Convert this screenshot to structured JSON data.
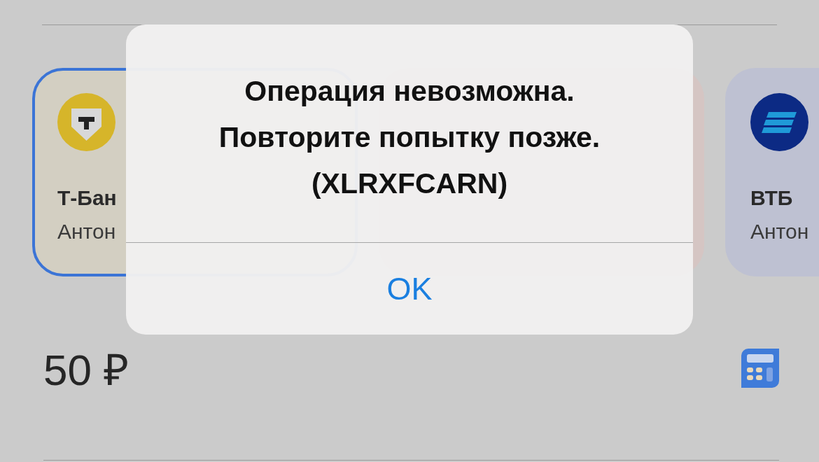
{
  "cards": [
    {
      "kind": "t",
      "name": "Т-Бан",
      "holder": "Антон",
      "selected": true,
      "color": "#d3cfc2"
    },
    {
      "kind": "hidden",
      "selected": false,
      "color": "#d5c5c3"
    },
    {
      "kind": "vtb",
      "name": "ВТБ",
      "holder": "Антон",
      "selected": false,
      "color": "#bec1d2"
    }
  ],
  "amount": "50 ₽",
  "dialog": {
    "message": "Операция невозможна.\nПовторите попытку позже.\n(XLRXFCARN)",
    "button": "OK"
  }
}
